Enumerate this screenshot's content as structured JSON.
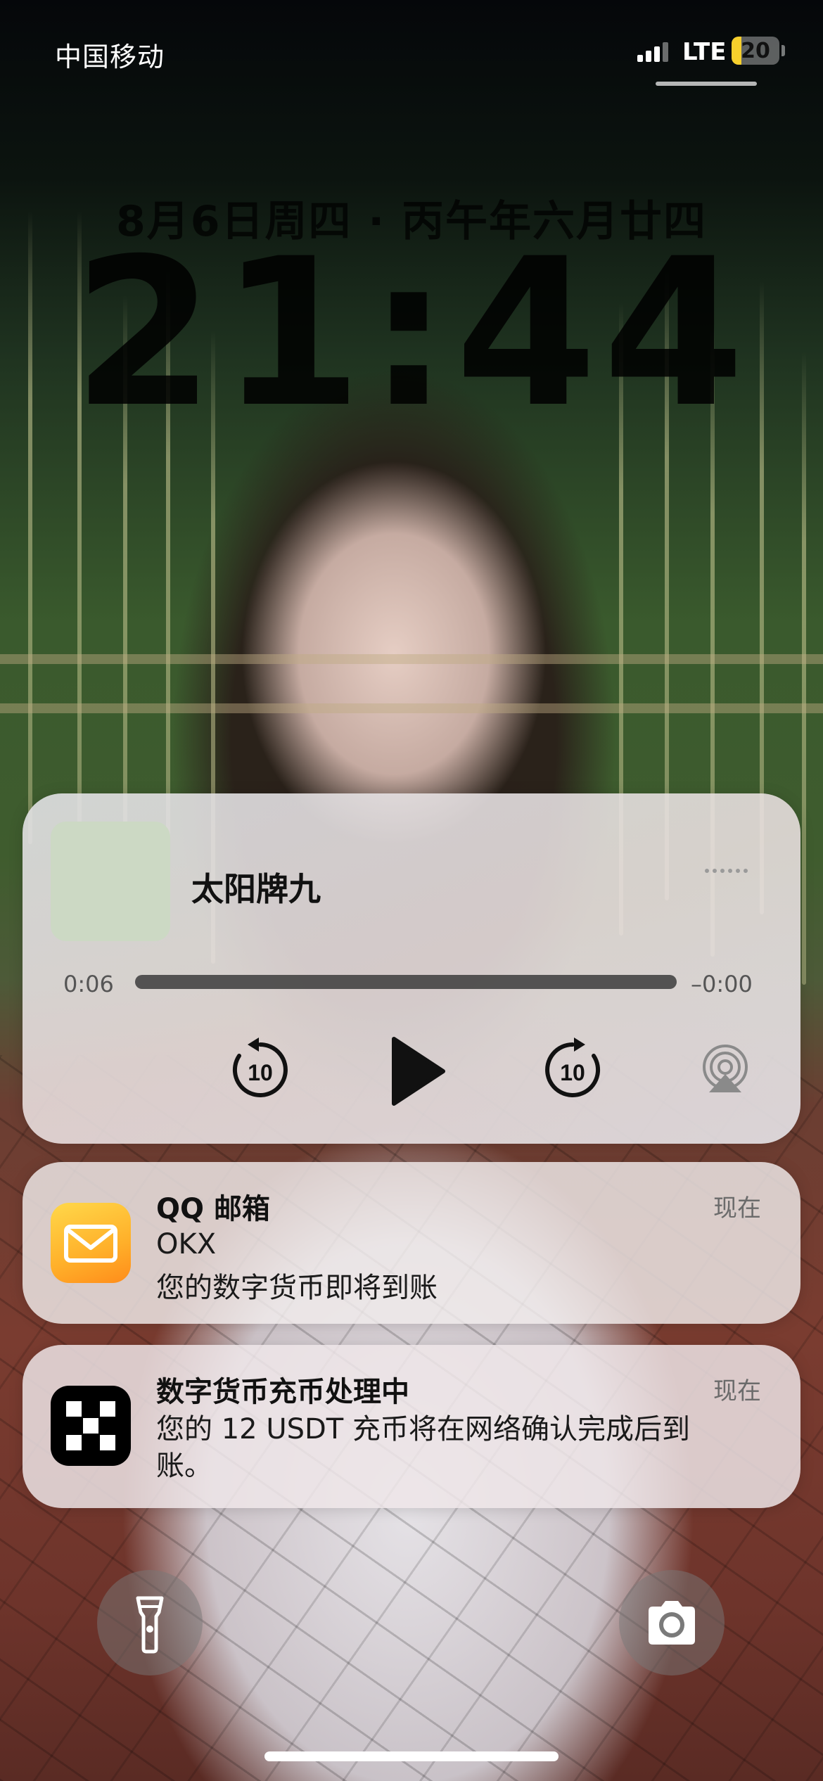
{
  "status_bar": {
    "carrier": "中国移动",
    "network": "LTE",
    "battery_level": "20",
    "battery_fraction": 0.2,
    "battery_color": "#f7cf2c"
  },
  "lock_screen": {
    "date": "8月6日周四 · 丙午年六月廿四",
    "time": "21:44"
  },
  "media": {
    "title": "太阳牌九",
    "elapsed": "0:06",
    "remaining": "–0:00",
    "progress": 0.0,
    "skip_back_seconds": "10",
    "skip_forward_seconds": "10",
    "icons": [
      "more-icon",
      "skip-back-icon",
      "play-icon",
      "skip-forward-icon",
      "airplay-icon"
    ]
  },
  "notifications": [
    {
      "app": "QQ 邮箱",
      "sender": "OKX",
      "body": "您的数字货币即将到账",
      "time": "现在",
      "icon": "mail-icon"
    },
    {
      "app": "数字货币充币处理中",
      "body": "您的 12 USDT 充币将在网络确认完成后到账。",
      "time": "现在",
      "icon": "okx-icon"
    }
  ],
  "quick_actions": {
    "left": "flashlight-icon",
    "right": "camera-icon"
  }
}
